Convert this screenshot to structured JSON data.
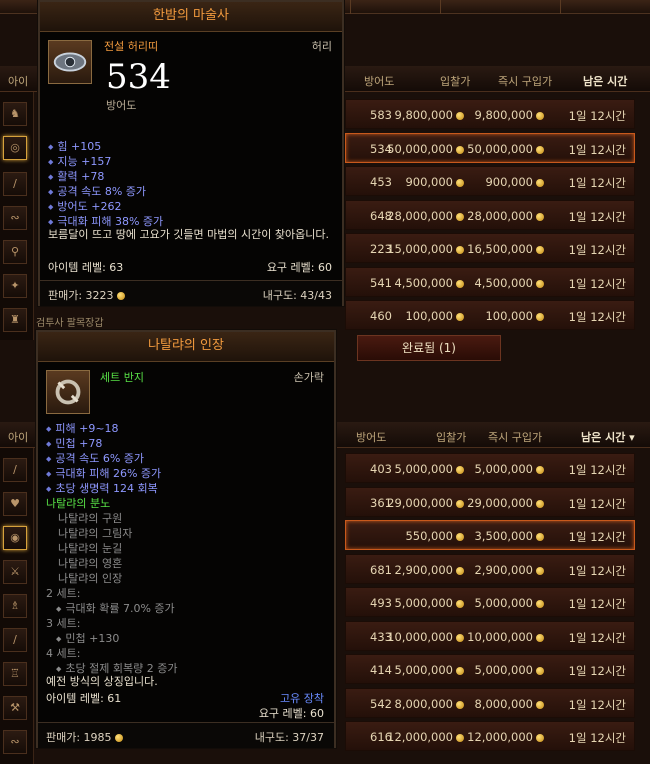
{
  "top_header": {
    "armor": "방어도",
    "bid": "입찰가",
    "buyout": "즉시 구입가",
    "time": "남은 시간",
    "left_label": "아이"
  },
  "bottom_header": {
    "armor": "방어도",
    "bid": "입찰가",
    "buyout": "즉시 구입가",
    "time": "남은 시간 ▾",
    "left_label": "아이"
  },
  "top_rows": [
    {
      "armor": "583",
      "bid": "9,800,000",
      "buy": "9,800,000",
      "time": "1일 12시간",
      "selected": false
    },
    {
      "armor": "534",
      "bid": "50,000,000",
      "buy": "50,000,000",
      "time": "1일 12시간",
      "selected": true
    },
    {
      "armor": "453",
      "bid": "900,000",
      "buy": "900,000",
      "time": "1일 12시간",
      "selected": false
    },
    {
      "armor": "648",
      "bid": "28,000,000",
      "buy": "28,000,000",
      "time": "1일 12시간",
      "selected": false
    },
    {
      "armor": "223",
      "bid": "15,000,000",
      "buy": "16,500,000",
      "time": "1일 12시간",
      "selected": false
    },
    {
      "armor": "541",
      "bid": "4,500,000",
      "buy": "4,500,000",
      "time": "1일 12시간",
      "selected": false
    },
    {
      "armor": "460",
      "bid": "100,000",
      "buy": "100,000",
      "time": "1일 12시간",
      "selected": false
    }
  ],
  "bottom_rows": [
    {
      "armor": "403",
      "bid": "5,000,000",
      "buy": "5,000,000",
      "time": "1일 12시간",
      "selected": false
    },
    {
      "armor": "361",
      "bid": "29,000,000",
      "buy": "29,000,000",
      "time": "1일 12시간",
      "selected": false
    },
    {
      "armor": "",
      "bid": "550,000",
      "buy": "3,500,000",
      "time": "1일 12시간",
      "selected": true
    },
    {
      "armor": "681",
      "bid": "2,900,000",
      "buy": "2,900,000",
      "time": "1일 12시간",
      "selected": false
    },
    {
      "armor": "493",
      "bid": "5,000,000",
      "buy": "5,000,000",
      "time": "1일 12시간",
      "selected": false
    },
    {
      "armor": "433",
      "bid": "10,000,000",
      "buy": "10,000,000",
      "time": "1일 12시간",
      "selected": false
    },
    {
      "armor": "414",
      "bid": "5,000,000",
      "buy": "5,000,000",
      "time": "1일 12시간",
      "selected": false
    },
    {
      "armor": "542",
      "bid": "8,000,000",
      "buy": "8,000,000",
      "time": "1일 12시간",
      "selected": false
    },
    {
      "armor": "616",
      "bid": "12,000,000",
      "buy": "12,000,000",
      "time": "1일 12시간",
      "selected": false
    }
  ],
  "completed_tab": "완료됨 (1)",
  "plate_label": "검투사 팔목장갑",
  "tooltip1": {
    "title": "한밤의 마술사",
    "type": "전설 허리띠",
    "slot": "허리",
    "value": "534",
    "value_label": "방어도",
    "affixes": [
      "힘 +105",
      "지능 +157",
      "활력 +78",
      "공격 속도 8% 증가",
      "방어도 +262",
      "극대화 피해 38% 증가"
    ],
    "flavor": "보름달이 뜨고 땅에 고요가 깃들면 마법의 시간이 찾아옵니다.",
    "item_level": "아이템 레벨: 63",
    "required_level": "요구 레벨: 60",
    "sell": "판매가: 3223",
    "durability": "내구도: 43/43"
  },
  "tooltip2": {
    "title": "나탈랴의 인장",
    "type": "세트 반지",
    "slot": "손가락",
    "affixes": [
      "피해 +9~18",
      "민첩 +78",
      "공격 속도 6% 증가",
      "극대화 피해 26% 증가",
      "초당 생명력 124 회복"
    ],
    "set_name": "나탈랴의 분노",
    "set_pieces": [
      "나탈랴의 구원",
      "나탈랴의 그림자",
      "나탈랴의 눈길",
      "나탈랴의 영혼",
      "나탈랴의 인장"
    ],
    "bonus2": "2 세트:",
    "bonus2_affix": "극대화 확률 7.0% 증가",
    "bonus3": "3 세트:",
    "bonus3_affix": "민첩 +130",
    "bonus4": "4 세트:",
    "bonus4_affix": "초당 절제 회복량 2 증가",
    "flavor": "예전 방식의 상징입니다.",
    "item_level": "아이템 레벨: 61",
    "unique": "고유 장착",
    "required_level": "요구 레벨: 60",
    "sell": "판매가: 1985",
    "durability": "내구도: 37/37"
  },
  "colors": {
    "legendary": "#f19a3e",
    "set": "#58e046",
    "magic": "#8e98ff",
    "selected_border": "#c8591c"
  }
}
